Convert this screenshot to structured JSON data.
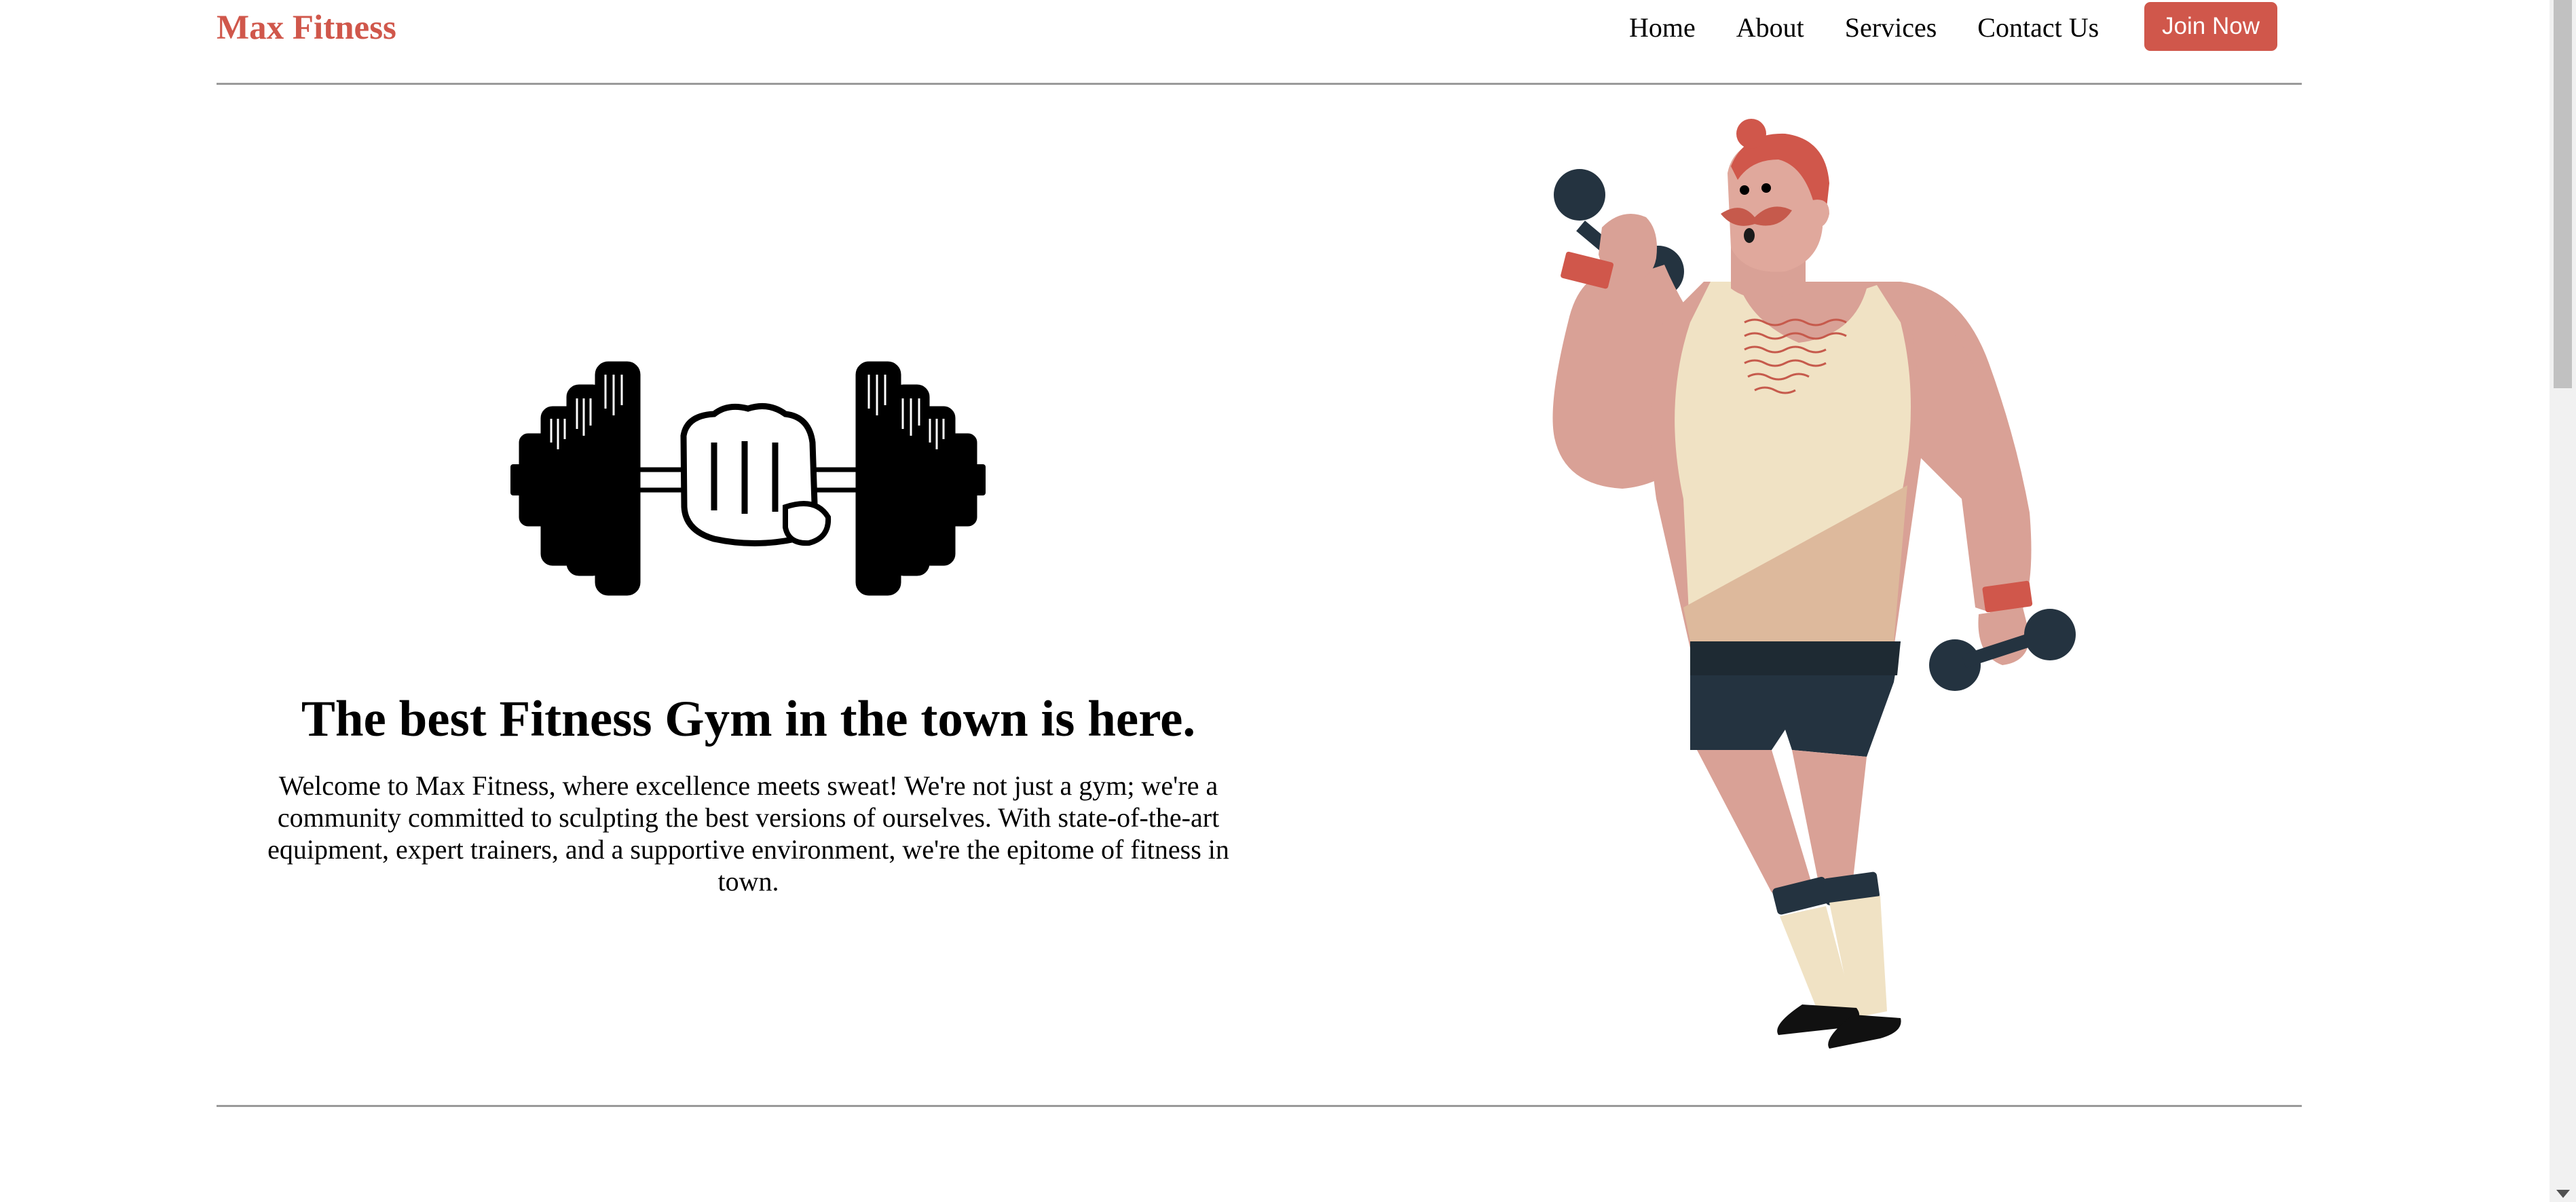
{
  "header": {
    "brand": "Max Fitness",
    "nav": [
      {
        "label": "Home"
      },
      {
        "label": "About"
      },
      {
        "label": "Services"
      },
      {
        "label": "Contact Us"
      }
    ],
    "cta_label": "Join Now"
  },
  "hero": {
    "headline": "The best Fitness Gym in the town is here.",
    "intro": "Welcome to Max Fitness, where excellence meets sweat! We're not just a gym; we're a community committed to sculpting the best versions of ourselves. With state-of-the-art equipment, expert trainers, and a supportive environment, we're the epitome of fitness in town.",
    "logo_icon": "dumbbell-fist-icon",
    "illustration": "man-lifting-dumbbells-illustration"
  },
  "colors": {
    "accent": "#d0574b",
    "rule": "#9a9a9a",
    "text": "#000000",
    "background": "#ffffff"
  }
}
